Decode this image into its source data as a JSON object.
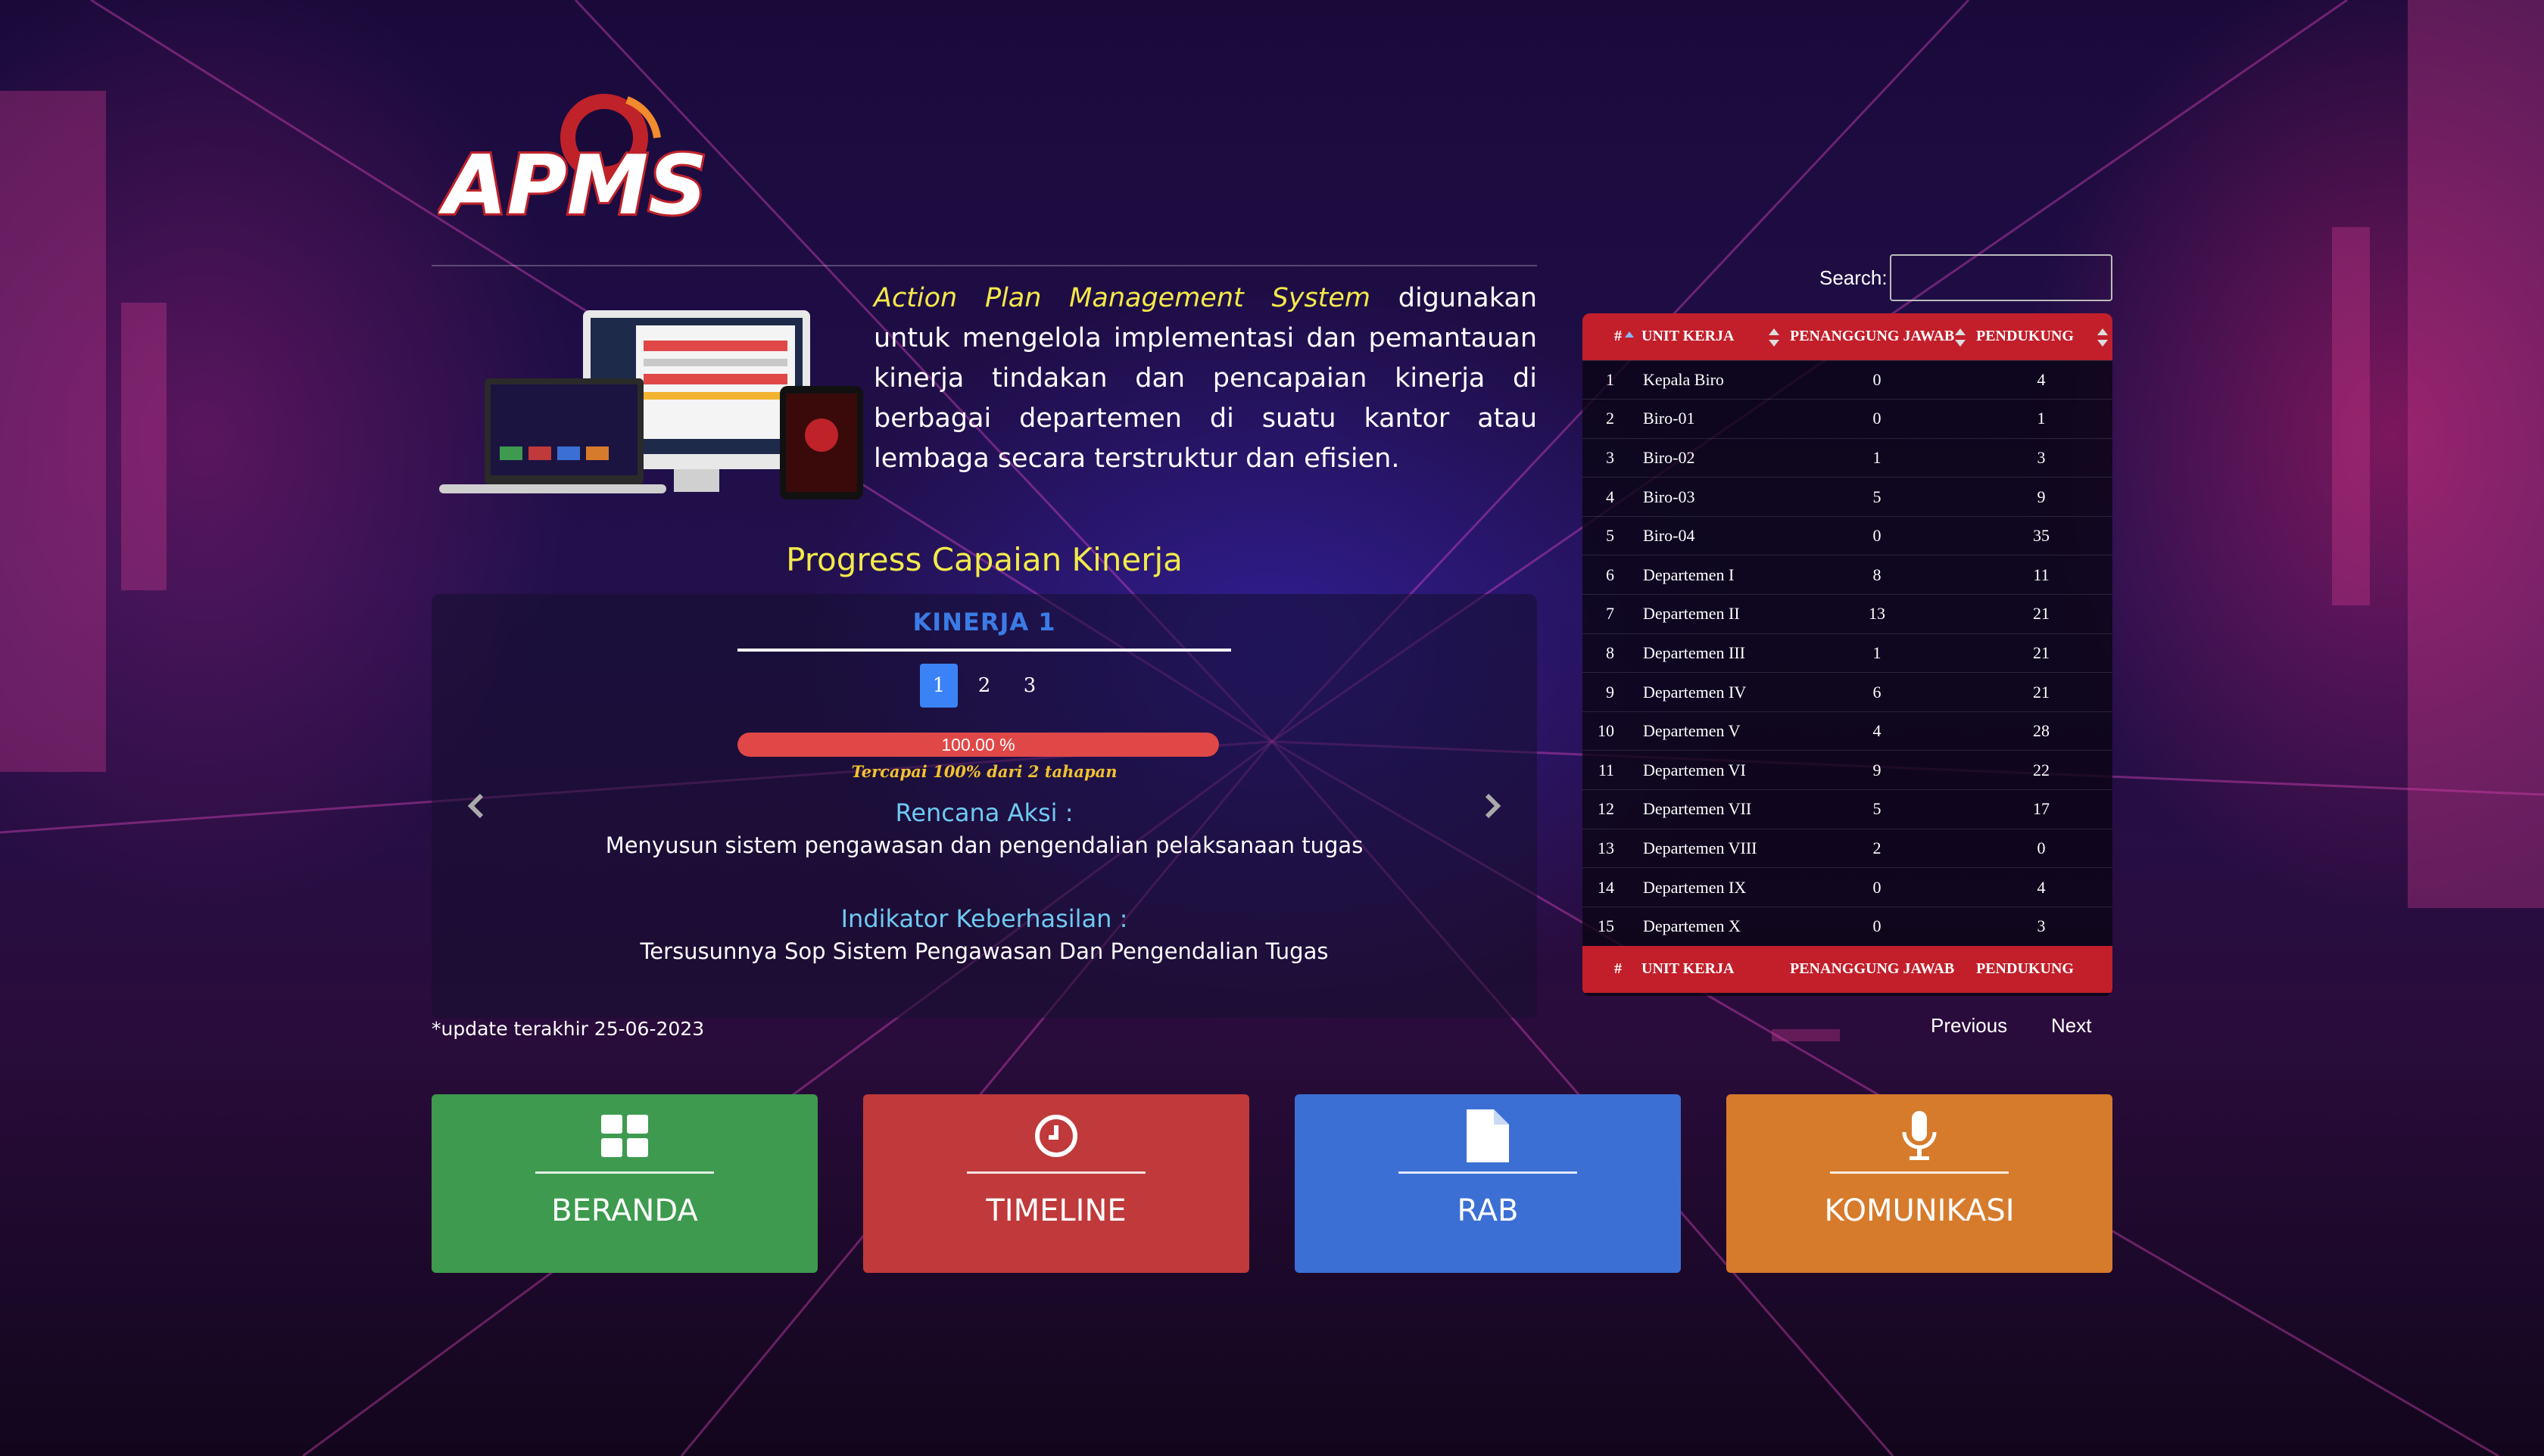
{
  "header": {
    "logo_text": "APMS"
  },
  "intro": {
    "highlight": "Action Plan Management System",
    "text": " digunakan untuk mengelola implementasi dan pemantauan kinerja tindakan dan pencapaian kinerja di berbagai departemen di suatu kantor atau lembaga secara terstruktur dan efisien."
  },
  "progress": {
    "title": "Progress Capaian Kinerja",
    "kinerja_title": "KINERJA 1",
    "pages": [
      "1",
      "2",
      "3"
    ],
    "active_page": "1",
    "percent_label": "100.00 %",
    "percent_value": 100,
    "tercapai": "Tercapai 100% dari 2 tahapan",
    "rencana_label": "Rencana Aksi :",
    "rencana_text": "Menyusun sistem pengawasan dan pengendalian pelaksanaan tugas",
    "indikator_label": "Indikator Keberhasilan :",
    "indikator_text": "Tersusunnya Sop Sistem Pengawasan Dan Pengendalian Tugas",
    "update_note": "*update terakhir 25-06-2023"
  },
  "search": {
    "label": "Search:",
    "value": ""
  },
  "table": {
    "headers": [
      "#",
      "UNIT KERJA",
      "PENANGGUNG JAWAB",
      "PENDUKUNG"
    ],
    "rows": [
      [
        "1",
        "Kepala Biro",
        "0",
        "4"
      ],
      [
        "2",
        "Biro-01",
        "0",
        "1"
      ],
      [
        "3",
        "Biro-02",
        "1",
        "3"
      ],
      [
        "4",
        "Biro-03",
        "5",
        "9"
      ],
      [
        "5",
        "Biro-04",
        "0",
        "35"
      ],
      [
        "6",
        "Departemen I",
        "8",
        "11"
      ],
      [
        "7",
        "Departemen II",
        "13",
        "21"
      ],
      [
        "8",
        "Departemen III",
        "1",
        "21"
      ],
      [
        "9",
        "Departemen IV",
        "6",
        "21"
      ],
      [
        "10",
        "Departemen V",
        "4",
        "28"
      ],
      [
        "11",
        "Departemen VI",
        "9",
        "22"
      ],
      [
        "12",
        "Departemen VII",
        "5",
        "17"
      ],
      [
        "13",
        "Departemen VIII",
        "2",
        "0"
      ],
      [
        "14",
        "Departemen IX",
        "0",
        "4"
      ],
      [
        "15",
        "Departemen X",
        "0",
        "3"
      ]
    ],
    "prev_label": "Previous",
    "next_label": "Next"
  },
  "nav": [
    {
      "label": "BERANDA",
      "icon": "grid-icon",
      "color": "#3d9a4e"
    },
    {
      "label": "TIMELINE",
      "icon": "clock-icon",
      "color": "#c0393b"
    },
    {
      "label": "RAB",
      "icon": "document-icon",
      "color": "#3b6fd4"
    },
    {
      "label": "KOMUNIKASI",
      "icon": "microphone-icon",
      "color": "#d67b2c"
    }
  ]
}
